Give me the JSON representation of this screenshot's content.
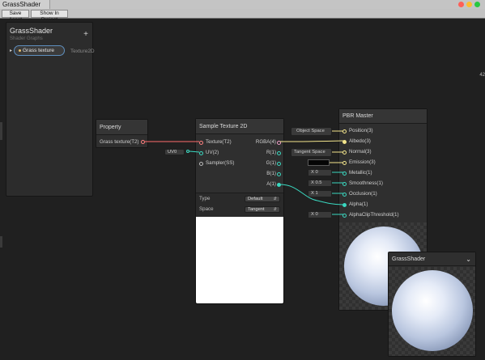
{
  "window": {
    "title": "GrassShader",
    "colors": {
      "close": "#ff5f57",
      "minimize": "#febc2e",
      "maximize": "#28c840"
    }
  },
  "toolbar": {
    "save_label": "Save Asset",
    "show_label": "Show In Project"
  },
  "side_label": "42",
  "blackboard": {
    "title": "GrassShader",
    "subtitle": "Shader Graphs",
    "add_icon": "plus-icon",
    "property": {
      "name": "Grass texture",
      "type": "Texture2D"
    }
  },
  "property_node": {
    "title": "Property",
    "output": "Grass texture(T2)"
  },
  "uv_field": {
    "value": "UV0"
  },
  "sample_node": {
    "title": "Sample Texture 2D",
    "inputs": [
      "Texture(T2)",
      "UV(2)",
      "Sampler(SS)"
    ],
    "outputs": [
      "RGBA(4)",
      "R(1)",
      "G(1)",
      "B(1)",
      "A(1)"
    ],
    "type_label": "Type",
    "type_value": "Default",
    "space_label": "Space",
    "space_value": "Tangent"
  },
  "pbr_node": {
    "title": "PBR Master",
    "inputs": [
      "Position(3)",
      "Albedo(3)",
      "Normal(3)",
      "Emission(3)",
      "Metallic(1)",
      "Smoothness(1)",
      "Occlusion(1)",
      "Alpha(1)",
      "AlphaClipThreshold(1)"
    ],
    "fields": {
      "position_space": "Object Space",
      "normal_space": "Tangent Space",
      "metallic": "X  0",
      "smoothness": "X  0.5",
      "occlusion": "X  1",
      "alpha_clip": "X  0"
    }
  },
  "preview": {
    "title": "GrassShader",
    "chevron_icon": "chevron-down-icon"
  }
}
